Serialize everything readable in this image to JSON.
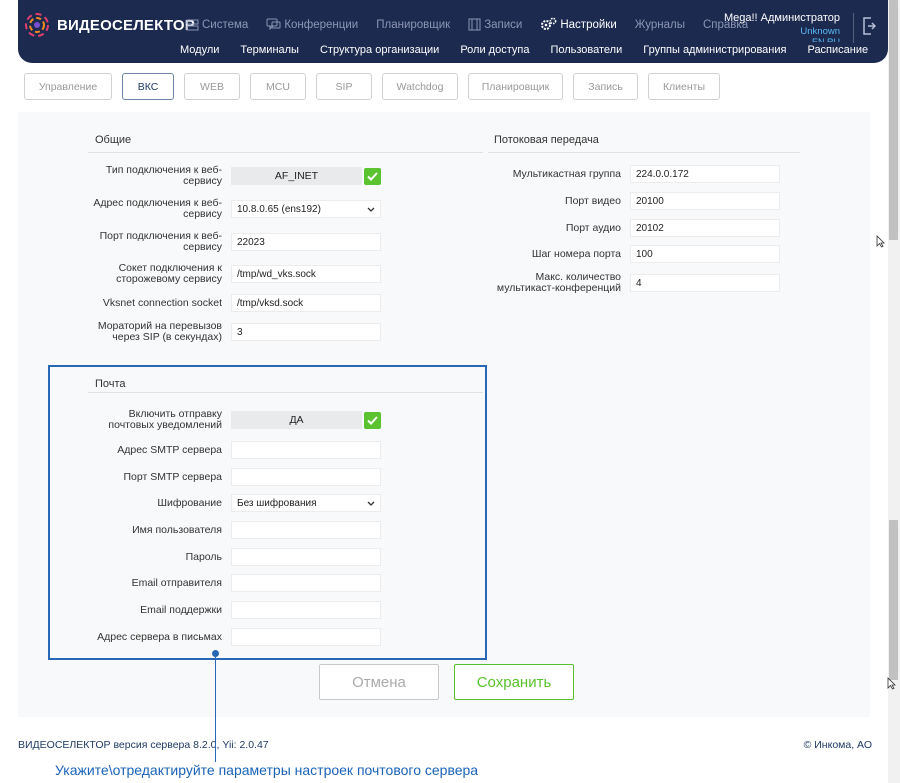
{
  "app": {
    "logo_text": "ВИДЕОСЕЛЕКТОР",
    "top_nav": [
      {
        "label": "Система",
        "icon": "server-icon",
        "active": false
      },
      {
        "label": "Конференции",
        "icon": "chat-icon",
        "active": false
      },
      {
        "label": "Планировщик",
        "icon": "",
        "active": false
      },
      {
        "label": "Записи",
        "icon": "film-icon",
        "active": false
      },
      {
        "label": "Настройки",
        "icon": "gears-icon",
        "active": true
      },
      {
        "label": "Журналы",
        "icon": "",
        "active": false
      },
      {
        "label": "Справка",
        "icon": "",
        "active": false
      }
    ],
    "sub_nav": [
      "Модули",
      "Терминалы",
      "Структура организации",
      "Роли доступа",
      "Пользователи",
      "Группы администрирования",
      "Расписание"
    ],
    "user": {
      "name": "Mega!! Администратор",
      "role": "Unknown",
      "extra": "EN RU"
    }
  },
  "tabs": [
    {
      "label": "Управление",
      "active": false
    },
    {
      "label": "ВКС",
      "active": true
    },
    {
      "label": "WEB",
      "active": false
    },
    {
      "label": "MCU",
      "active": false
    },
    {
      "label": "SIP",
      "active": false
    },
    {
      "label": "Watchdog",
      "active": false
    },
    {
      "label": "Планировщик",
      "active": false
    },
    {
      "label": "Запись",
      "active": false
    },
    {
      "label": "Клиенты",
      "active": false
    }
  ],
  "general": {
    "title": "Общие",
    "fields": [
      {
        "label": "Тип подключения к веб-сервису",
        "value": "AF_INET",
        "kind": "toggle"
      },
      {
        "label": "Адрес подключения к веб-сервису",
        "value": "10.8.0.65 (ens192)",
        "kind": "select"
      },
      {
        "label": "Порт подключения к веб-сервису",
        "value": "22023",
        "kind": "input"
      },
      {
        "label": "Сокет подключения к сторожевому сервису",
        "value": "/tmp/wd_vks.sock",
        "kind": "input"
      },
      {
        "label": "Vksnet connection socket",
        "value": "/tmp/vksd.sock",
        "kind": "input"
      },
      {
        "label": "Мораторий на перевызов через SIP (в секундах)",
        "value": "3",
        "kind": "input"
      }
    ]
  },
  "streaming": {
    "title": "Потоковая передача",
    "fields": [
      {
        "label": "Мультикастная группа",
        "value": "224.0.0.172"
      },
      {
        "label": "Порт видео",
        "value": "20100"
      },
      {
        "label": "Порт аудио",
        "value": "20102"
      },
      {
        "label": "Шаг номера порта",
        "value": "100"
      },
      {
        "label": "Макс. количество мультикаст-конференций",
        "value": "4"
      }
    ]
  },
  "mail": {
    "title": "Почта",
    "fields": [
      {
        "label": "Включить отправку почтовых уведомлений",
        "value": "ДА",
        "kind": "toggle"
      },
      {
        "label": "Адрес SMTP сервера",
        "value": "",
        "kind": "input"
      },
      {
        "label": "Порт SMTP сервера",
        "value": "",
        "kind": "input"
      },
      {
        "label": "Шифрование",
        "value": "Без шифрования",
        "kind": "select"
      },
      {
        "label": "Имя пользователя",
        "value": "",
        "kind": "input"
      },
      {
        "label": "Пароль",
        "value": "",
        "kind": "input"
      },
      {
        "label": "Email отправителя",
        "value": "",
        "kind": "input"
      },
      {
        "label": "Email поддержки",
        "value": "",
        "kind": "input"
      },
      {
        "label": "Адрес сервера в письмах",
        "value": "",
        "kind": "input"
      }
    ]
  },
  "buttons": {
    "cancel": "Отмена",
    "save": "Сохранить"
  },
  "footer": {
    "version": "ВИДЕОСЕЛЕКТОР версия сервера 8.2.0, Yii: 2.0.47",
    "copyright": "© Инкома, АО"
  },
  "callout": "Укажите\\отредактируйте параметры настроек почтового сервера",
  "colors": {
    "header": "#1c2a4f",
    "accent": "#2866b6",
    "success": "#5ac32f"
  }
}
